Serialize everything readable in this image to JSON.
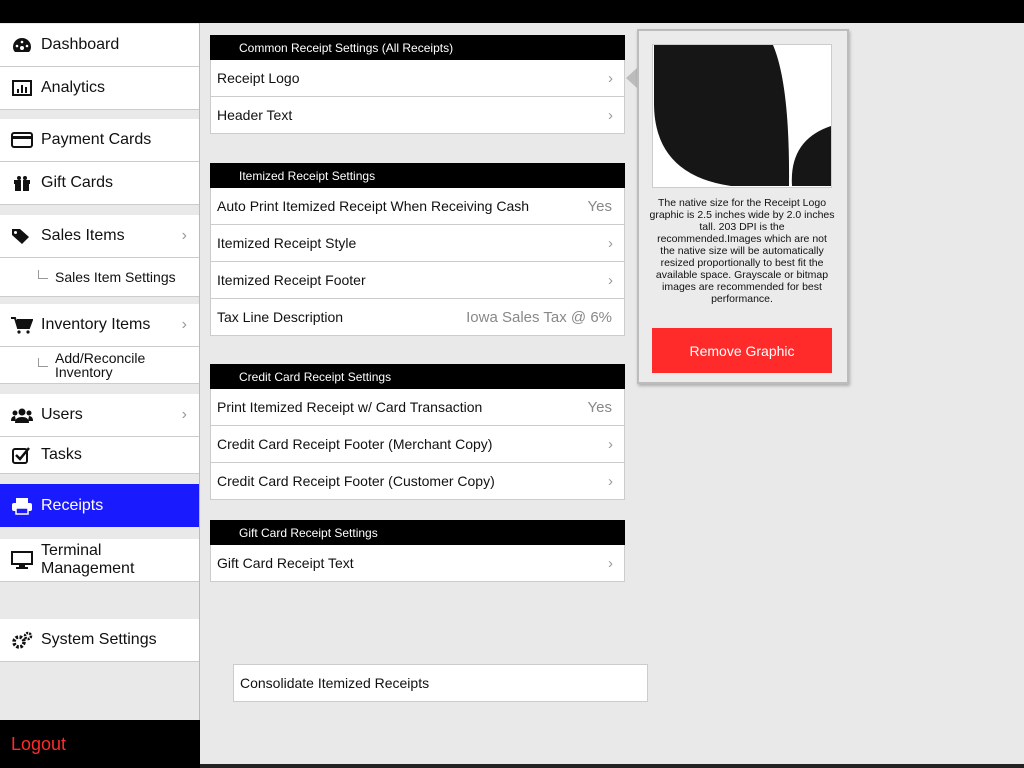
{
  "sidebar": {
    "items": [
      {
        "label": "Dashboard",
        "icon": "dashboard-icon"
      },
      {
        "label": "Analytics",
        "icon": "bar-chart-icon"
      },
      {
        "label": "Payment Cards",
        "icon": "credit-card-icon"
      },
      {
        "label": "Gift Cards",
        "icon": "gift-icon"
      },
      {
        "label": "Sales Items",
        "icon": "tags-icon"
      },
      {
        "label": "Sales Item Settings"
      },
      {
        "label": "Inventory Items",
        "icon": "cart-icon"
      },
      {
        "label": "Add/Reconcile Inventory"
      },
      {
        "label": "Users",
        "icon": "users-icon"
      },
      {
        "label": "Tasks",
        "icon": "checkbox-icon"
      },
      {
        "label": "Receipts",
        "icon": "printer-icon"
      },
      {
        "label": "Terminal Management",
        "icon": "monitor-icon"
      },
      {
        "label": "System Settings",
        "icon": "gears-icon"
      }
    ],
    "logout": "Logout",
    "active_color": "#1a1aff"
  },
  "sections": [
    {
      "title": "Common Receipt Settings (All Receipts)",
      "rows": [
        {
          "label": "Receipt Logo"
        },
        {
          "label": "Header Text"
        }
      ]
    },
    {
      "title": "Itemized Receipt Settings",
      "rows": [
        {
          "label": "Auto Print Itemized Receipt When Receiving Cash",
          "value": "Yes"
        },
        {
          "label": "Itemized Receipt Style"
        },
        {
          "label": "Itemized Receipt Footer"
        },
        {
          "label": "Tax Line Description",
          "value": "Iowa Sales Tax @ 6%"
        }
      ]
    },
    {
      "title": "Credit Card Receipt Settings",
      "rows": [
        {
          "label": "Print Itemized Receipt w/ Card Transaction",
          "value": "Yes"
        },
        {
          "label": "Credit Card Receipt Footer (Merchant Copy)"
        },
        {
          "label": "Credit Card Receipt Footer (Customer Copy)"
        }
      ]
    },
    {
      "title": "Gift Card Receipt Settings",
      "rows": [
        {
          "label": "Gift Card Receipt Text"
        }
      ]
    }
  ],
  "consolidate": "Consolidate Itemized Receipts",
  "popover": {
    "text": "The native size for the Receipt Logo graphic is 2.5 inches wide by 2.0 inches tall. 203 DPI is the recommended.Images which are not the native size will be automatically resized proportionally to best fit the available space. Grayscale or bitmap images are recommended for best performance.",
    "button": "Remove Graphic",
    "button_color": "#ff2a2a"
  }
}
